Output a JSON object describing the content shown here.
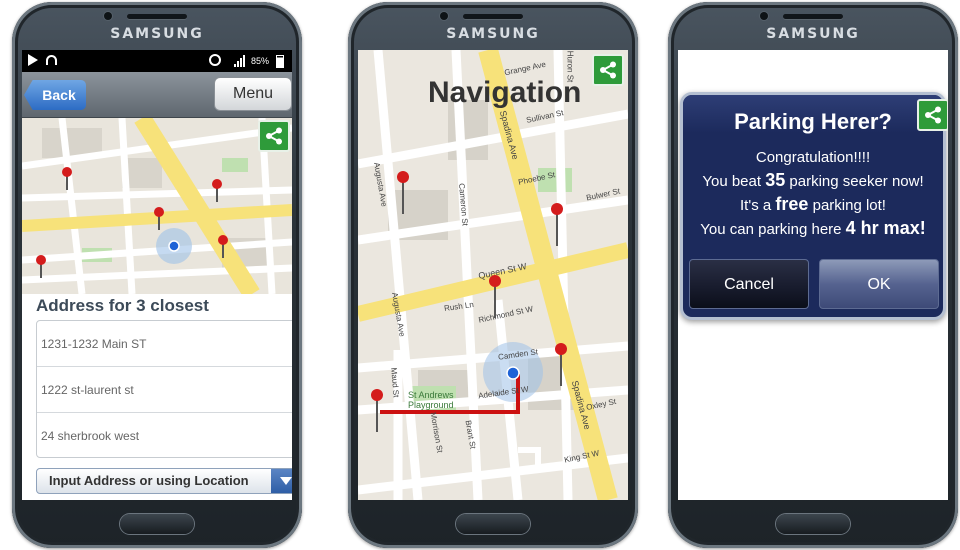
{
  "brand": "SAMSUNG",
  "phone1": {
    "status": {
      "battery": "85%"
    },
    "topbar": {
      "back_label": "Back",
      "menu_label": "Menu"
    },
    "section_title": "Address for 3 closest",
    "addresses": [
      "1231-1232 Main ST",
      "1222 st-laurent st",
      "24 sherbrook west"
    ],
    "select_label": "Input Address or using Location"
  },
  "phone2": {
    "title": "Navigation",
    "streets": {
      "grange": "Grange Ave",
      "huron": "Huron St",
      "sullivan": "Sullivan St",
      "spadina": "Spadina Ave",
      "phoebe": "Phoebe St",
      "bulwer": "Bulwer St",
      "augusta": "Augusta Ave",
      "cameron": "Cameron St",
      "queen": "Queen St W",
      "richmond": "Richmond St W",
      "rush": "Rush Ln",
      "camden": "Camden St",
      "adelaide": "Adelaide St W",
      "oxley": "Oxley St",
      "maud": "Maud St",
      "brant": "Brant St",
      "morrison": "Morrison St",
      "king": "King St W",
      "standrews": "St Andrews Playground"
    }
  },
  "phone3": {
    "dialog_title": "Parking Herer?",
    "line1": "Congratulation!!!!",
    "line2_pre": "You beat ",
    "line2_num": "35",
    "line2_post": " parking seeker now!",
    "line3_pre": "It's a ",
    "line3_bold": "free",
    "line3_post": " parking lot!",
    "line4_pre": "You can parking here ",
    "line4_bold": "4 hr max!",
    "cancel_label": "Cancel",
    "ok_label": "OK"
  },
  "colors": {
    "route": "#cc1111",
    "share_green": "#2e9b3a",
    "dialog_bg": "#1c2a5c"
  },
  "icons": [
    "play-icon",
    "headset-icon",
    "alarm-icon",
    "signal-icon",
    "battery-icon",
    "share-icon",
    "dropdown-arrow-icon",
    "map-pin-icon",
    "location-dot-icon"
  ]
}
